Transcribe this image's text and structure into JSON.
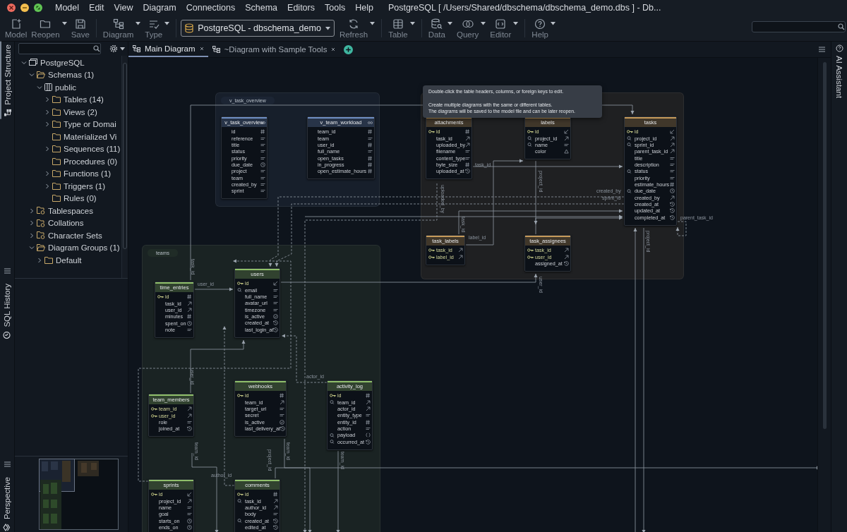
{
  "window": {
    "title": "PostgreSQL [ /Users/Shared/dbschema/dbschema_demo.dbs ] - Db..."
  },
  "menu": [
    "Model",
    "Edit",
    "View",
    "Diagram",
    "Connections",
    "Schema",
    "Editors",
    "Tools",
    "Help"
  ],
  "toolbar": [
    [
      {
        "label": "Model",
        "dropdown": false
      },
      {
        "label": "Reopen",
        "dropdown": true
      },
      {
        "label": "Save",
        "dropdown": false
      }
    ],
    [
      {
        "label": "Diagram",
        "dropdown": true
      },
      {
        "label": "Type",
        "dropdown": true
      }
    ],
    [
      {
        "kind": "combo",
        "label": "PostgreSQL - dbschema_demo",
        "dropdown": true
      },
      {
        "kind": "button",
        "label": "Refresh",
        "dropdown": true
      }
    ],
    [
      {
        "label": "Table",
        "dropdown": true
      }
    ],
    [
      {
        "label": "Data",
        "dropdown": true
      },
      {
        "label": "Query",
        "dropdown": true
      },
      {
        "label": "Editor",
        "dropdown": true
      }
    ],
    [
      {
        "label": "Help",
        "dropdown": true
      }
    ]
  ],
  "left_strip": [
    {
      "label": "Project Structure",
      "selected": true
    },
    {
      "label": "SQL History",
      "selected": false
    },
    {
      "label": "Perspective",
      "selected": false
    }
  ],
  "right_strip": [
    "AI Assistant"
  ],
  "tree": [
    {
      "label": "PostgreSQL",
      "kind": "connection",
      "expanded": true,
      "children": [
        {
          "label": "Schemas (1)",
          "kind": "folder",
          "expanded": true,
          "children": [
            {
              "label": "public",
              "kind": "schema",
              "expanded": true,
              "children": [
                {
                  "label": "Tables (14)",
                  "kind": "folder",
                  "expanded": false
                },
                {
                  "label": "Views (2)",
                  "kind": "folder",
                  "expanded": false
                },
                {
                  "label": "Type or Domai",
                  "kind": "folder",
                  "expanded": false
                },
                {
                  "label": "Materialized Vi",
                  "kind": "empty-folder",
                  "expanded": false
                },
                {
                  "label": "Sequences (11)",
                  "kind": "folder",
                  "expanded": false
                },
                {
                  "label": "Procedures (0)",
                  "kind": "empty-folder",
                  "expanded": false
                },
                {
                  "label": "Functions (1)",
                  "kind": "folder",
                  "expanded": false
                },
                {
                  "label": "Triggers (1)",
                  "kind": "folder",
                  "expanded": false
                },
                {
                  "label": "Rules (0)",
                  "kind": "empty-folder",
                  "expanded": false
                }
              ]
            }
          ]
        },
        {
          "label": "Tablespaces",
          "kind": "special-folder",
          "expanded": false
        },
        {
          "label": "Collations",
          "kind": "special-folder",
          "expanded": false
        },
        {
          "label": "Character Sets",
          "kind": "special-folder",
          "expanded": false
        },
        {
          "label": "Diagram Groups (1)",
          "kind": "folder",
          "expanded": true,
          "children": [
            {
              "label": "Default",
              "kind": "folder",
              "expanded": false
            }
          ]
        }
      ]
    }
  ],
  "tabs": [
    {
      "label": "Main Diagram",
      "selected": true
    },
    {
      "label": "~Diagram with Sample Tools",
      "selected": false
    }
  ],
  "groups": [
    {
      "label": "v_task_overview",
      "color": "#6f8fc4",
      "tables": [
        {
          "name": "v_task_overview",
          "kind": "view",
          "columns": [
            {
              "name": "id",
              "kind": "plain"
            },
            {
              "name": "reference",
              "kind": "plain"
            },
            {
              "name": "title",
              "kind": "plain"
            },
            {
              "name": "status",
              "kind": "plain"
            },
            {
              "name": "priority",
              "kind": "plain"
            },
            {
              "name": "due_date",
              "kind": "plain"
            },
            {
              "name": "project",
              "kind": "plain"
            },
            {
              "name": "team",
              "kind": "plain"
            },
            {
              "name": "created_by",
              "kind": "plain"
            },
            {
              "name": "sprint",
              "kind": "plain"
            }
          ]
        },
        {
          "name": "v_team_workload",
          "kind": "view",
          "columns": [
            {
              "name": "team_id",
              "kind": "plain"
            },
            {
              "name": "team",
              "kind": "plain"
            },
            {
              "name": "user_id",
              "kind": "plain"
            },
            {
              "name": "full_name",
              "kind": "plain"
            },
            {
              "name": "open_tasks",
              "kind": "plain"
            },
            {
              "name": "in_progress",
              "kind": "plain"
            },
            {
              "name": "open_estimate_hours",
              "kind": "plain"
            }
          ]
        }
      ]
    },
    {
      "color": "#c69a5a",
      "tables": [
        {
          "name": "attachments",
          "kind": "table",
          "columns": [
            {
              "name": "id",
              "kind": "primary"
            },
            {
              "name": "task_id",
              "kind": "plain"
            },
            {
              "name": "uploaded_by",
              "kind": "plain"
            },
            {
              "name": "filename",
              "kind": "plain"
            },
            {
              "name": "content_type",
              "kind": "plain"
            },
            {
              "name": "byte_size",
              "kind": "plain"
            },
            {
              "name": "uploaded_at",
              "kind": "plain"
            }
          ]
        },
        {
          "name": "labels",
          "kind": "table",
          "columns": [
            {
              "name": "id",
              "kind": "primary"
            },
            {
              "name": "project_id",
              "kind": "indexed"
            },
            {
              "name": "name",
              "kind": "indexed"
            },
            {
              "name": "color",
              "kind": "plain"
            }
          ]
        },
        {
          "name": "tasks",
          "kind": "table",
          "columns": [
            {
              "name": "id",
              "kind": "primary"
            },
            {
              "name": "project_id",
              "kind": "indexed"
            },
            {
              "name": "sprint_id",
              "kind": "indexed"
            },
            {
              "name": "parent_task_id",
              "kind": "plain"
            },
            {
              "name": "title",
              "kind": "plain"
            },
            {
              "name": "description",
              "kind": "plain"
            },
            {
              "name": "status",
              "kind": "indexed"
            },
            {
              "name": "priority",
              "kind": "plain"
            },
            {
              "name": "estimate_hours",
              "kind": "plain"
            },
            {
              "name": "due_date",
              "kind": "indexed"
            },
            {
              "name": "created_by",
              "kind": "plain"
            },
            {
              "name": "created_at",
              "kind": "plain"
            },
            {
              "name": "updated_at",
              "kind": "plain"
            },
            {
              "name": "completed_at",
              "kind": "plain"
            }
          ]
        },
        {
          "name": "task_labels",
          "kind": "table",
          "columns": [
            {
              "name": "task_id",
              "kind": "primary"
            },
            {
              "name": "label_id",
              "kind": "primary"
            }
          ]
        },
        {
          "name": "task_assignees",
          "kind": "table",
          "columns": [
            {
              "name": "task_id",
              "kind": "primary"
            },
            {
              "name": "user_id",
              "kind": "primary"
            },
            {
              "name": "assigned_at",
              "kind": "plain"
            }
          ]
        }
      ]
    },
    {
      "label": "teams",
      "color": "#8fbf6a",
      "tables": [
        {
          "name": "time_entries",
          "kind": "table",
          "columns": [
            {
              "name": "id",
              "kind": "primary"
            },
            {
              "name": "task_id",
              "kind": "plain"
            },
            {
              "name": "user_id",
              "kind": "plain"
            },
            {
              "name": "minutes",
              "kind": "plain"
            },
            {
              "name": "spent_on",
              "kind": "plain"
            },
            {
              "name": "note",
              "kind": "plain"
            }
          ]
        },
        {
          "name": "users",
          "kind": "table",
          "columns": [
            {
              "name": "id",
              "kind": "primary"
            },
            {
              "name": "email",
              "kind": "indexed"
            },
            {
              "name": "full_name",
              "kind": "plain"
            },
            {
              "name": "avatar_url",
              "kind": "plain"
            },
            {
              "name": "timezone",
              "kind": "plain"
            },
            {
              "name": "is_active",
              "kind": "plain"
            },
            {
              "name": "created_at",
              "kind": "plain"
            },
            {
              "name": "last_login_at",
              "kind": "plain"
            }
          ]
        },
        {
          "name": "team_members",
          "kind": "table",
          "columns": [
            {
              "name": "team_id",
              "kind": "primary"
            },
            {
              "name": "user_id",
              "kind": "primary"
            },
            {
              "name": "role",
              "kind": "plain"
            },
            {
              "name": "joined_at",
              "kind": "plain"
            }
          ]
        },
        {
          "name": "webhooks",
          "kind": "table",
          "columns": [
            {
              "name": "id",
              "kind": "primary"
            },
            {
              "name": "team_id",
              "kind": "plain"
            },
            {
              "name": "target_url",
              "kind": "plain"
            },
            {
              "name": "secret",
              "kind": "plain"
            },
            {
              "name": "is_active",
              "kind": "plain"
            },
            {
              "name": "last_delivery_at",
              "kind": "plain"
            }
          ]
        },
        {
          "name": "activity_log",
          "kind": "table",
          "columns": [
            {
              "name": "id",
              "kind": "primary"
            },
            {
              "name": "team_id",
              "kind": "indexed"
            },
            {
              "name": "actor_id",
              "kind": "plain"
            },
            {
              "name": "entity_type",
              "kind": "plain"
            },
            {
              "name": "entity_id",
              "kind": "plain"
            },
            {
              "name": "action",
              "kind": "plain"
            },
            {
              "name": "payload",
              "kind": "indexed"
            },
            {
              "name": "occurred_at",
              "kind": "indexed"
            }
          ]
        },
        {
          "name": "sprints",
          "kind": "table",
          "columns": [
            {
              "name": "id",
              "kind": "primary"
            },
            {
              "name": "project_id",
              "kind": "plain"
            },
            {
              "name": "name",
              "kind": "plain"
            },
            {
              "name": "goal",
              "kind": "plain"
            },
            {
              "name": "starts_on",
              "kind": "plain"
            },
            {
              "name": "ends_on",
              "kind": "plain"
            }
          ]
        },
        {
          "name": "comments",
          "kind": "table",
          "columns": [
            {
              "name": "id",
              "kind": "primary"
            },
            {
              "name": "task_id",
              "kind": "indexed"
            },
            {
              "name": "author_id",
              "kind": "plain"
            },
            {
              "name": "body",
              "kind": "plain"
            },
            {
              "name": "created_at",
              "kind": "indexed"
            },
            {
              "name": "edited_at",
              "kind": "plain"
            }
          ]
        }
      ]
    }
  ],
  "relationship_labels": [
    {
      "text": "task_id",
      "kind": "horizontal"
    },
    {
      "text": "label_id",
      "kind": "horizontal"
    },
    {
      "text": "created_by",
      "kind": "horizontal"
    },
    {
      "text": "sprint_id",
      "kind": "horizontal"
    },
    {
      "text": "parent_task_id",
      "kind": "horizontal"
    },
    {
      "text": "user_id",
      "kind": "horizontal"
    },
    {
      "text": "actor_id",
      "kind": "horizontal"
    },
    {
      "text": "author_id",
      "kind": "horizontal"
    },
    {
      "text": "uploaded_by",
      "kind": "vertical"
    },
    {
      "text": "project_id",
      "kind": "vertical"
    },
    {
      "text": "task_id",
      "kind": "vertical"
    },
    {
      "text": "task_id",
      "kind": "vertical"
    },
    {
      "text": "user_id",
      "kind": "vertical"
    },
    {
      "text": "project_id",
      "kind": "vertical"
    },
    {
      "text": "user_id",
      "kind": "vertical"
    },
    {
      "text": "team_id",
      "kind": "vertical"
    },
    {
      "text": "team_id",
      "kind": "vertical"
    },
    {
      "text": "team_id",
      "kind": "vertical"
    },
    {
      "text": "project_id",
      "kind": "vertical"
    }
  ],
  "tooltip": {
    "lines": [
      "Double-click the table headers, columns, or foreign keys to edit.",
      "Create multiple diagrams with the same or different tables.",
      "The diagrams will be saved to the model file and can be later reopen."
    ]
  }
}
